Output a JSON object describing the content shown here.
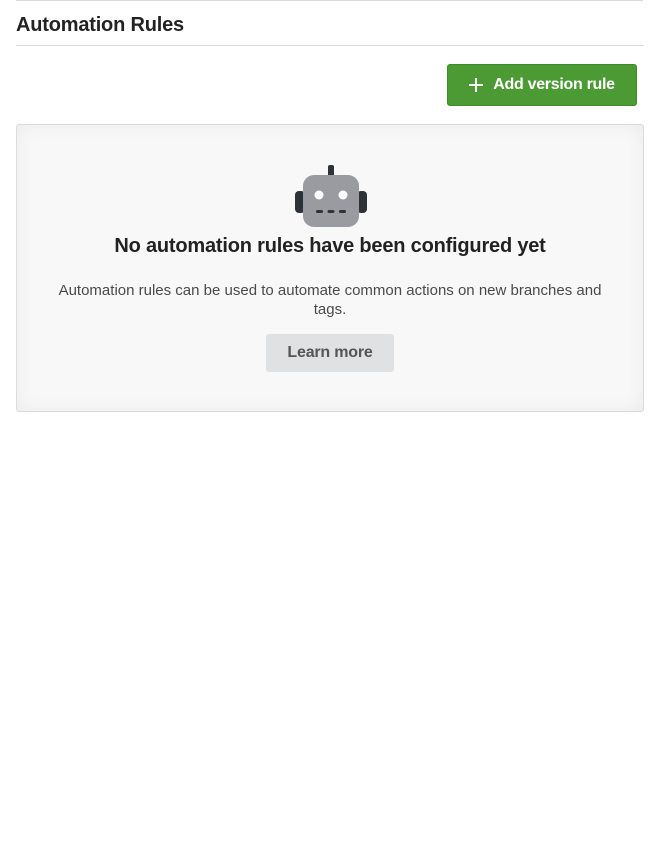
{
  "header": {
    "title": "Automation Rules"
  },
  "toolbar": {
    "add_button_label": "Add version rule",
    "add_button_icon": "plus-icon",
    "add_button_color": "#4b9a34"
  },
  "empty_state": {
    "icon": "robot-icon",
    "heading": "No automation rules have been configured yet",
    "description": "Automation rules can be used to automate common actions on new branches and tags.",
    "learn_more_label": "Learn more"
  }
}
